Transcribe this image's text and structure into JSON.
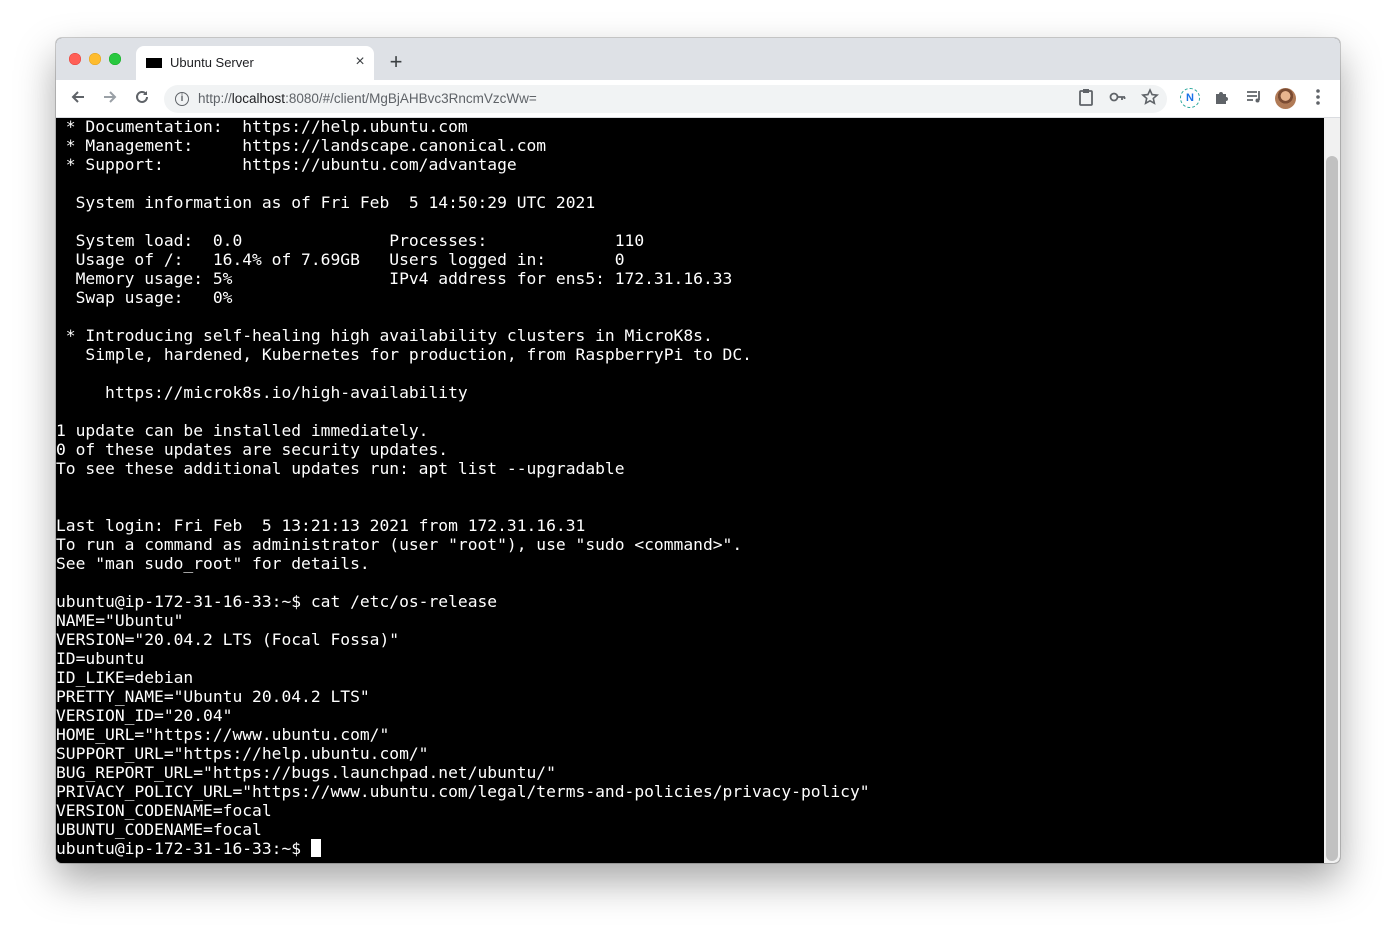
{
  "browser": {
    "tab": {
      "title": "Ubuntu Server",
      "close_glyph": "×"
    },
    "new_tab_glyph": "+",
    "url": {
      "scheme": "http://",
      "host": "localhost",
      "rest": ":8080/#/client/MgBjAHBvc3RncmVzcWw="
    },
    "icons": {
      "back": "arrow-left-icon",
      "forward": "arrow-right-icon",
      "reload": "reload-icon",
      "site_info": "info-icon",
      "clipboard": "clipboard-icon",
      "key": "key-icon",
      "star": "star-icon",
      "extension_n": "n-extension-icon",
      "extensions": "puzzle-icon",
      "media": "media-queue-icon",
      "profile": "avatar",
      "menu": "kebab-menu-icon"
    },
    "extension_n_label": "N"
  },
  "terminal": {
    "lines": [
      " * Documentation:  https://help.ubuntu.com",
      " * Management:     https://landscape.canonical.com",
      " * Support:        https://ubuntu.com/advantage",
      "",
      "  System information as of Fri Feb  5 14:50:29 UTC 2021",
      "",
      "  System load:  0.0               Processes:             110",
      "  Usage of /:   16.4% of 7.69GB   Users logged in:       0",
      "  Memory usage: 5%                IPv4 address for ens5: 172.31.16.33",
      "  Swap usage:   0%",
      "",
      " * Introducing self-healing high availability clusters in MicroK8s.",
      "   Simple, hardened, Kubernetes for production, from RaspberryPi to DC.",
      "",
      "     https://microk8s.io/high-availability",
      "",
      "1 update can be installed immediately.",
      "0 of these updates are security updates.",
      "To see these additional updates run: apt list --upgradable",
      "",
      "",
      "Last login: Fri Feb  5 13:21:13 2021 from 172.31.16.31",
      "To run a command as administrator (user \"root\"), use \"sudo <command>\".",
      "See \"man sudo_root\" for details.",
      "",
      "ubuntu@ip-172-31-16-33:~$ cat /etc/os-release",
      "NAME=\"Ubuntu\"",
      "VERSION=\"20.04.2 LTS (Focal Fossa)\"",
      "ID=ubuntu",
      "ID_LIKE=debian",
      "PRETTY_NAME=\"Ubuntu 20.04.2 LTS\"",
      "VERSION_ID=\"20.04\"",
      "HOME_URL=\"https://www.ubuntu.com/\"",
      "SUPPORT_URL=\"https://help.ubuntu.com/\"",
      "BUG_REPORT_URL=\"https://bugs.launchpad.net/ubuntu/\"",
      "PRIVACY_POLICY_URL=\"https://www.ubuntu.com/legal/terms-and-policies/privacy-policy\"",
      "VERSION_CODENAME=focal",
      "UBUNTU_CODENAME=focal"
    ],
    "prompt": "ubuntu@ip-172-31-16-33:~$ "
  },
  "colors": {
    "terminal_bg": "#000000",
    "terminal_fg": "#ffffff",
    "tabstrip_bg": "#dee1e6",
    "omnibox_bg": "#f1f3f4"
  }
}
